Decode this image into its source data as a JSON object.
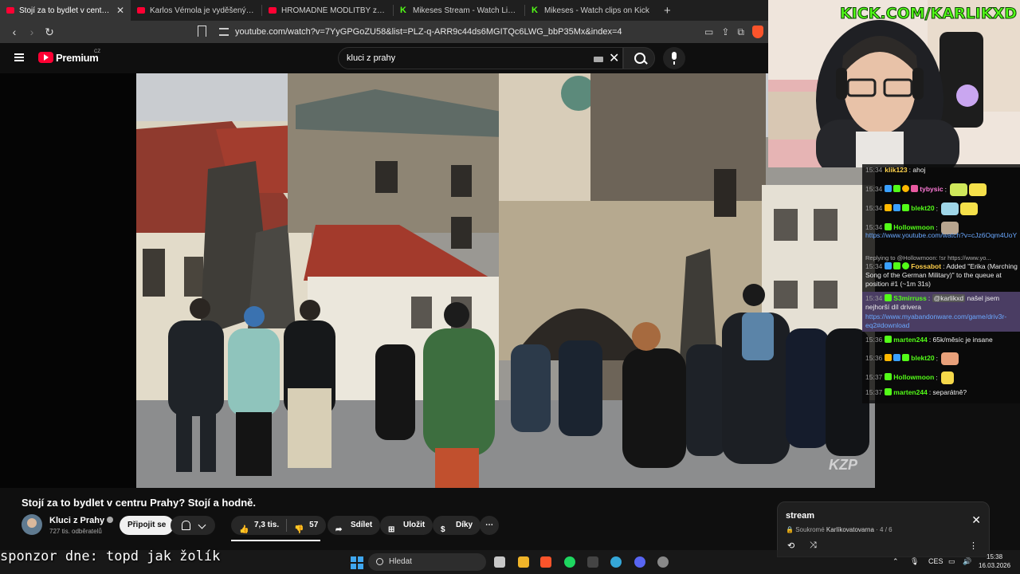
{
  "browser": {
    "tabs": [
      {
        "label": "Stojí za to bydlet v centru Prahy?",
        "icon": "youtube-icon",
        "active": true
      },
      {
        "label": "Karlos Vémola je vyděšený ze svého",
        "icon": "youtube-icon"
      },
      {
        "label": "HROMADNÉ MODLITBY za uzdravení",
        "icon": "youtube-icon"
      },
      {
        "label": "Mikeses Stream - Watch Live on Kick",
        "icon": "kick-icon"
      },
      {
        "label": "Mikeses - Watch clips on Kick",
        "icon": "kick-icon"
      }
    ],
    "new_tab": "+",
    "url": "youtube.com/watch?v=7YyGPGoZU58&list=PLZ-q-ARR9c44ds6MGITQc6LWG_bbP35Mx&index=4"
  },
  "youtube": {
    "brand": "Premium",
    "country": "CZ",
    "search_value": "kluci z prahy"
  },
  "video": {
    "watermark": "KZP",
    "title": "Stojí za to bydlet v centru Prahy? Stojí a hodně.",
    "channel": "Kluci z Prahy",
    "subscribers": "727 tis. odběratelů",
    "join_label": "Připojit se",
    "likes": "7,3 tis.",
    "dislikes": "57",
    "share_label": "Sdílet",
    "save_label": "Uložit",
    "thanks_label": "Díky"
  },
  "playlist_panel": {
    "title": "stream",
    "privacy": "Soukromé",
    "owner": "Karlíkovatovarna",
    "position": "4 / 6"
  },
  "webcam": {
    "banner": "KICK.COM/KARLIKXD"
  },
  "chat": {
    "messages": [
      {
        "time": "15:34",
        "user": "klik123",
        "text": "ahoj"
      },
      {
        "time": "15:34",
        "user": "tybysic",
        "text": ""
      },
      {
        "time": "15:34",
        "user": "blekt20",
        "text": ""
      },
      {
        "time": "15:34",
        "user": "Hollowmoon",
        "text": ""
      },
      {
        "time": "",
        "user": "",
        "text": "https://www.youtube.com/watch?v=cJz6Oqm4UoY"
      },
      {
        "time": "",
        "user": "",
        "text": "Replying to @Hollowmoon: !sr https://www.yo..."
      },
      {
        "time": "15:34",
        "user": "Fossabot",
        "text": "Added \"Erika (Marching Song of the German Military)\" to the queue at position #1 (~1m 31s)"
      },
      {
        "time": "15:34",
        "user": "S3mirruss",
        "mention": "@karlikxd",
        "text": "našel jsem nejhorší díl drivera"
      },
      {
        "time": "",
        "user": "",
        "text": "https://www.myabandonware.com/game/driv3r-eq2#download"
      },
      {
        "time": "15:36",
        "user": "marten244",
        "text": "65k/měsíc je insane"
      },
      {
        "time": "15:36",
        "user": "blekt20",
        "text": ""
      },
      {
        "time": "15:37",
        "user": "Hollowmoon",
        "text": ""
      },
      {
        "time": "15:37",
        "user": "marten244",
        "text": "separátně?"
      }
    ]
  },
  "overlay": {
    "sponsor": "sponzor dne: topd jak žolík"
  },
  "taskbar": {
    "search_label": "Hledat",
    "language": "CES",
    "time": "15:38",
    "date": "16.03.2026"
  },
  "colors": {
    "youtube_red": "#ff0033",
    "kick_green": "#53fc18",
    "chat_highlight": "#4a3d63"
  }
}
